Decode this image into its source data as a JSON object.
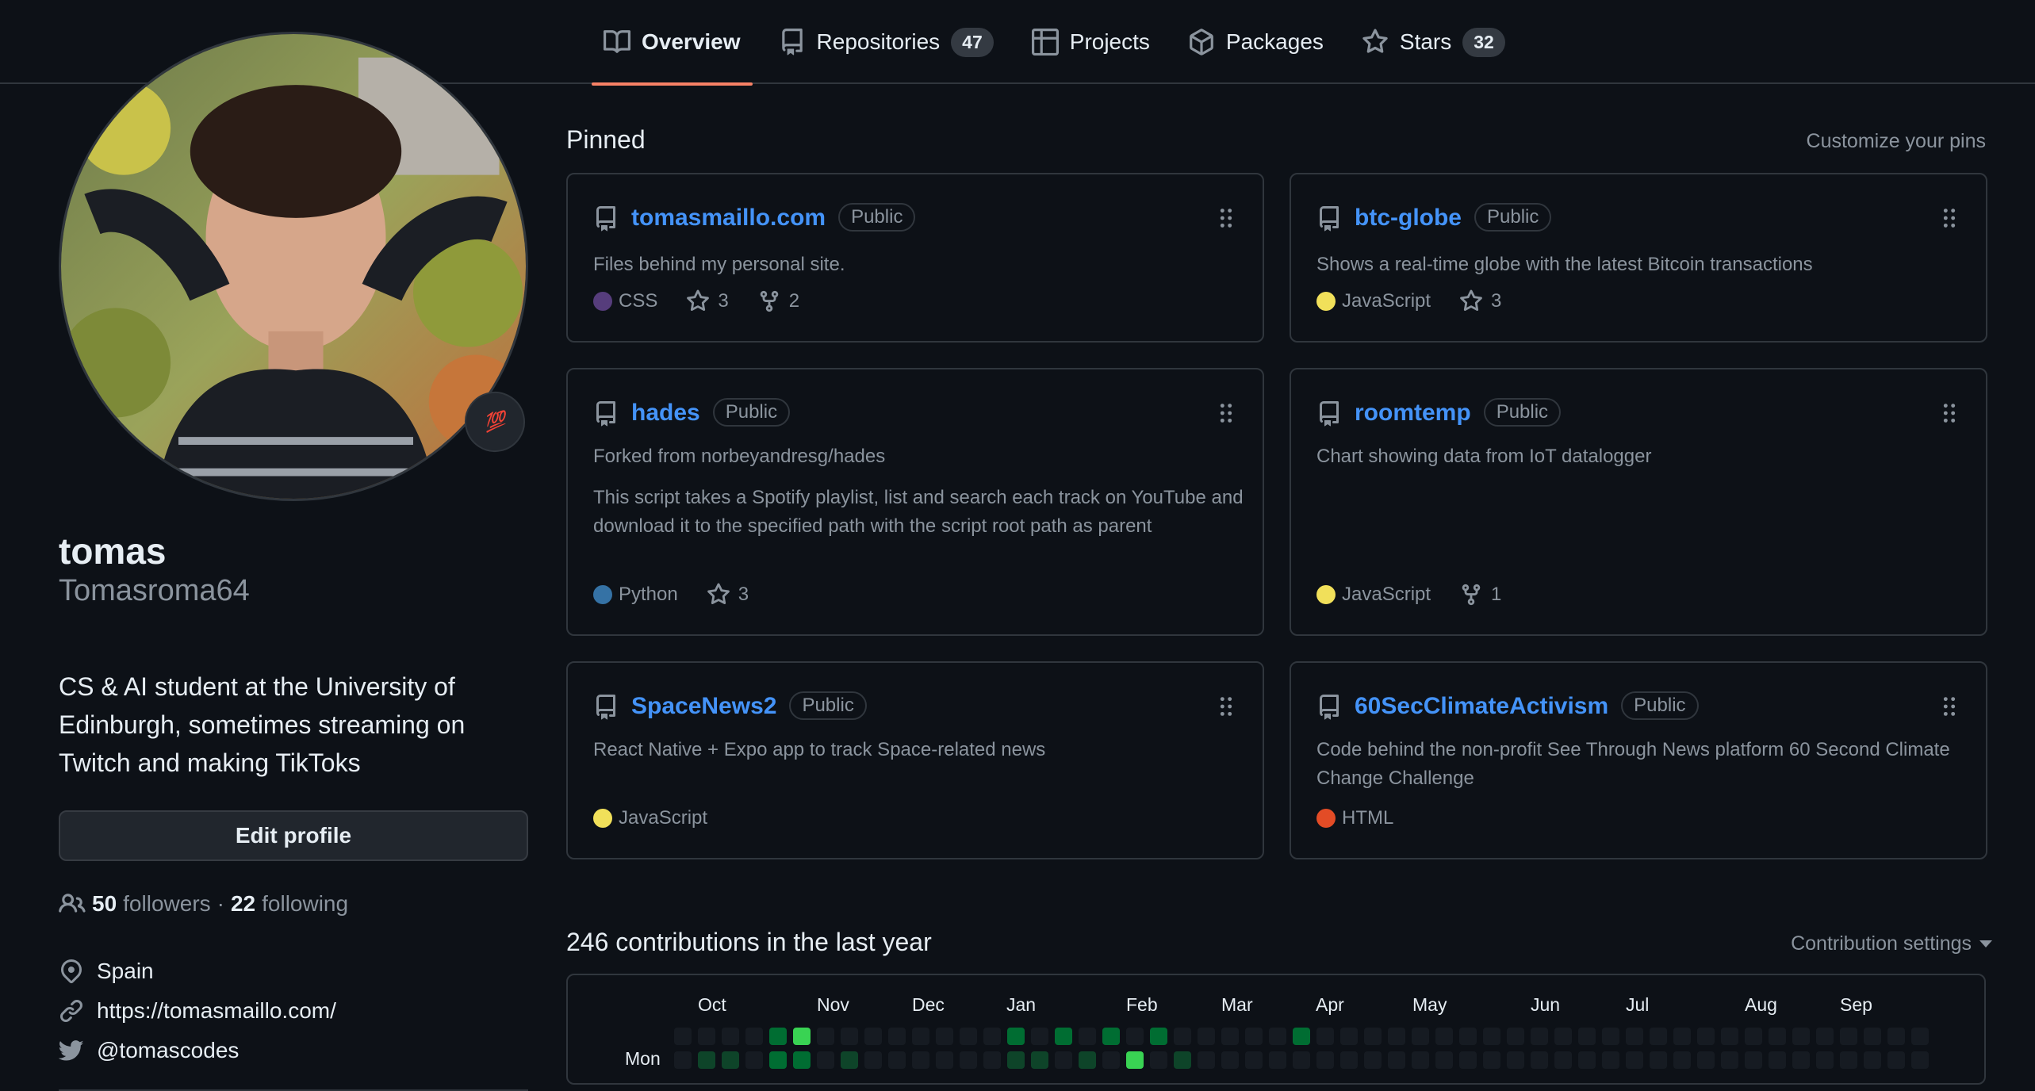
{
  "tabs": [
    {
      "label": "Overview",
      "icon": "book-icon",
      "active": true
    },
    {
      "label": "Repositories",
      "icon": "repo-icon",
      "count": "47"
    },
    {
      "label": "Projects",
      "icon": "table-icon"
    },
    {
      "label": "Packages",
      "icon": "package-icon"
    },
    {
      "label": "Stars",
      "icon": "star-icon",
      "count": "32"
    }
  ],
  "profile": {
    "status_emoji": "💯",
    "fullname": "tomas",
    "username": "Tomasroma64",
    "bio": "CS & AI student at the University of Edinburgh, sometimes streaming on Twitch and making TikToks",
    "edit_button": "Edit profile",
    "followers_count": "50",
    "followers_label": "followers",
    "separator": "·",
    "following_count": "22",
    "following_label": "following",
    "location": "Spain",
    "website": "https://tomasmaillo.com/",
    "twitter": "@tomascodes"
  },
  "pinned": {
    "title": "Pinned",
    "customize": "Customize your pins",
    "repos": [
      {
        "name": "tomasmaillo.com",
        "visibility": "Public",
        "forked_from": "",
        "description": "Files behind my personal site.",
        "language": "CSS",
        "lang_color": "#563d7c",
        "stars": "3",
        "forks": "2"
      },
      {
        "name": "btc-globe",
        "visibility": "Public",
        "forked_from": "",
        "description": "Shows a real-time globe with the latest Bitcoin transactions",
        "language": "JavaScript",
        "lang_color": "#f1e05a",
        "stars": "3",
        "forks": ""
      },
      {
        "name": "hades",
        "visibility": "Public",
        "forked_from": "Forked from norbeyandresg/hades",
        "description": "This script takes a Spotify playlist, list and search each track on YouTube and download it to the specified path with the script root path as parent",
        "language": "Python",
        "lang_color": "#3572A5",
        "stars": "3",
        "forks": ""
      },
      {
        "name": "roomtemp",
        "visibility": "Public",
        "forked_from": "",
        "description": "Chart showing data from IoT datalogger",
        "language": "JavaScript",
        "lang_color": "#f1e05a",
        "stars": "",
        "forks": "1"
      },
      {
        "name": "SpaceNews2",
        "visibility": "Public",
        "forked_from": "",
        "description": "React Native + Expo app to track Space-related news",
        "language": "JavaScript",
        "lang_color": "#f1e05a",
        "stars": "",
        "forks": ""
      },
      {
        "name": "60SecClimateActivism",
        "visibility": "Public",
        "forked_from": "",
        "description": "Code behind the non-profit See Through News platform 60 Second Climate Change Challenge",
        "language": "HTML",
        "lang_color": "#e34c26",
        "stars": "",
        "forks": ""
      }
    ]
  },
  "contributions": {
    "title": "246 contributions in the last year",
    "settings_label": "Contribution settings",
    "months": [
      "Oct",
      "Nov",
      "Dec",
      "Jan",
      "Feb",
      "Mar",
      "Apr",
      "May",
      "Jun",
      "Jul",
      "Aug",
      "Sep"
    ],
    "day_label": "Mon",
    "colors": [
      "#161b22",
      "#0e4429",
      "#006d32",
      "#26a641",
      "#39d353"
    ],
    "row0_levels": [
      0,
      0,
      0,
      0,
      2,
      4,
      0,
      0,
      0,
      0,
      0,
      0,
      0,
      0,
      2,
      0,
      2,
      0,
      2,
      0,
      2,
      0,
      0,
      0,
      0,
      0,
      2,
      0,
      0,
      0,
      0,
      0,
      0,
      0,
      0,
      0,
      0,
      0,
      0,
      0,
      0,
      0,
      0,
      0,
      0,
      0,
      0,
      0,
      0,
      0,
      0,
      0,
      0
    ],
    "row1_levels": [
      0,
      1,
      1,
      0,
      2,
      2,
      0,
      1,
      0,
      0,
      0,
      0,
      0,
      0,
      1,
      1,
      0,
      1,
      0,
      4,
      0,
      1,
      0,
      0,
      0,
      0,
      0,
      0,
      0,
      0,
      0,
      0,
      0,
      0,
      0,
      0,
      0,
      0,
      0,
      0,
      0,
      0,
      0,
      0,
      0,
      0,
      0,
      0,
      0,
      0,
      0,
      0,
      0
    ]
  }
}
